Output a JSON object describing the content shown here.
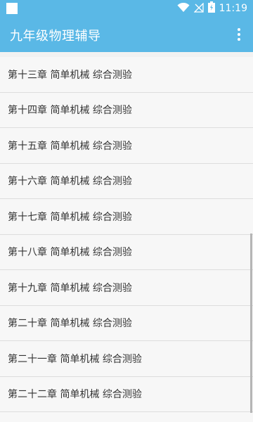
{
  "status_bar": {
    "time": "11:19",
    "icons": [
      "notification-square-icon",
      "wifi-icon",
      "no-signal-icon",
      "battery-charging-icon"
    ]
  },
  "app_bar": {
    "title": "九年级物理辅导",
    "menu_icon": "more-vert-icon"
  },
  "list": {
    "items": [
      {
        "label": "第十三章 简单机械 综合测验"
      },
      {
        "label": "第十四章 简单机械 综合测验"
      },
      {
        "label": "第十五章 简单机械 综合测验"
      },
      {
        "label": "第十六章 简单机械 综合测验"
      },
      {
        "label": "第十七章 简单机械 综合测验"
      },
      {
        "label": "第十八章 简单机械 综合测验"
      },
      {
        "label": "第十九章 简单机械 综合测验"
      },
      {
        "label": "第二十章 简单机械 综合测验"
      },
      {
        "label": "第二十一章 简单机械 综合测验"
      },
      {
        "label": "第二十二章 简单机械 综合测验"
      }
    ]
  },
  "colors": {
    "primary": "#5ab8e6",
    "list_background": "#f7f7f7",
    "divider": "#dddddd",
    "text": "#333333"
  }
}
